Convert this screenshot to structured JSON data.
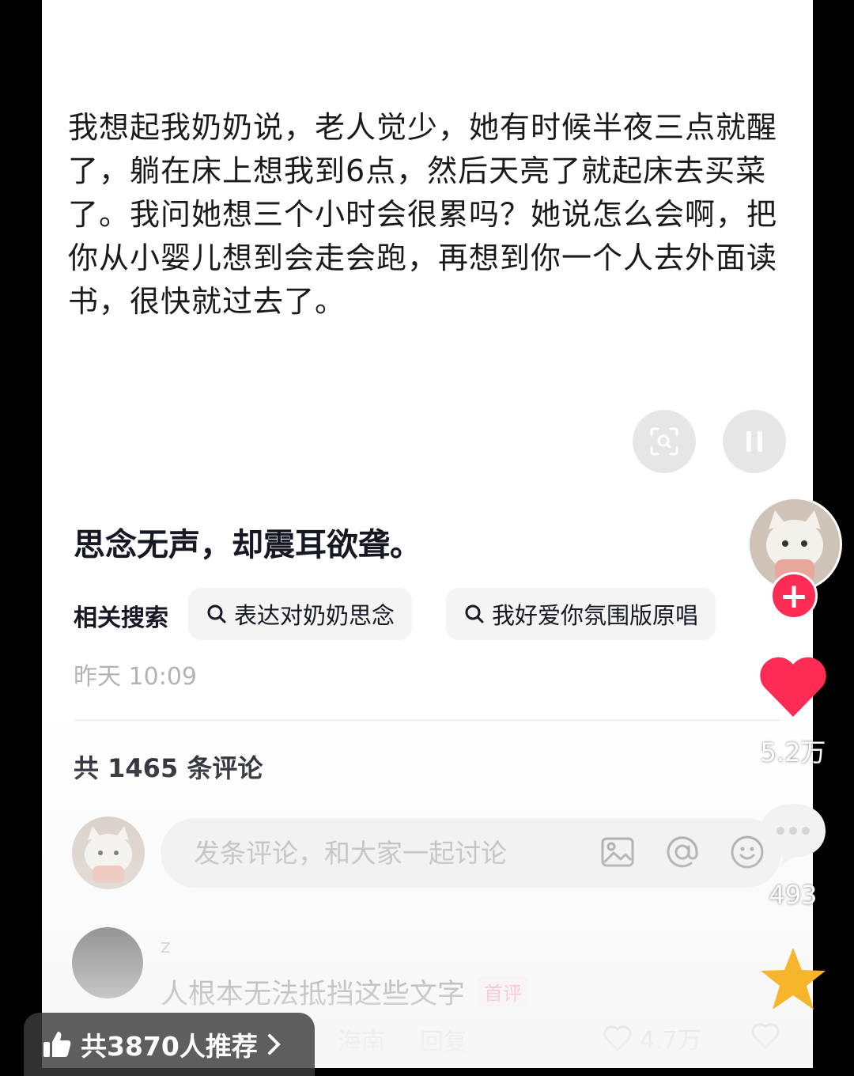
{
  "post": {
    "text": "我想起我奶奶说，老人觉少，她有时候半夜三点就醒了，躺在床上想我到6点，然后天亮了就起床去买菜了。我问她想三个小时会很累吗？她说怎么会啊，把你从小婴儿想到会走会跑，再想到你一个人去外面读书，很快就过去了。",
    "title": "思念无声，却震耳欲聋。",
    "related_label": "相关搜索",
    "related": [
      "表达对奶奶思念",
      "我好爱你氛围版原唱"
    ],
    "time": "昨天 10:09"
  },
  "comments": {
    "count_label": "共 1465 条评论",
    "input_placeholder": "发条评论，和大家一起讨论",
    "first": {
      "user": "z",
      "text": "人根本无法抵挡这些文字",
      "badge": "首评",
      "location": "海南",
      "reply_label": "回复",
      "likes": "4.7万"
    }
  },
  "sidebar": {
    "follow": "+",
    "likes": "5.2万",
    "comments": "493"
  },
  "bottom": {
    "recommend": "共3870人推荐"
  },
  "colors": {
    "accent": "#fe2c55",
    "star": "#f7b52c"
  }
}
